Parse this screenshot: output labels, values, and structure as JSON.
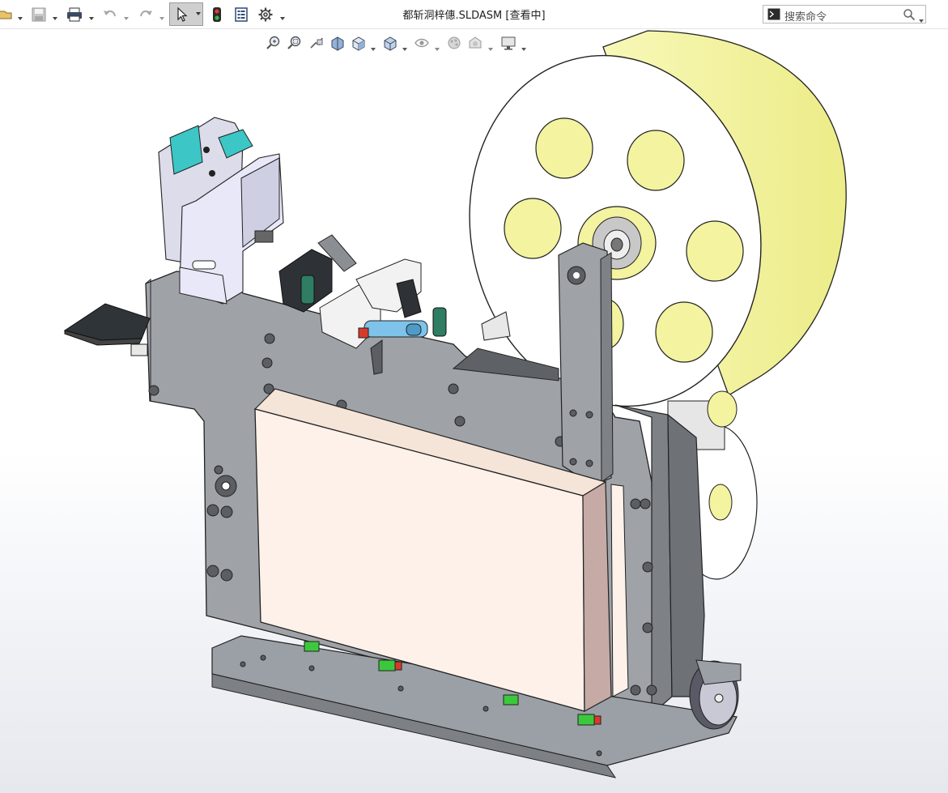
{
  "window": {
    "title": "都斩洞梓僡.SLDASM [查看中]"
  },
  "search": {
    "placeholder": "搜索命令"
  },
  "toolbar": {
    "icons": [
      "open-icon",
      "save-icon",
      "print-icon",
      "undo-icon",
      "redo-icon",
      "select-arrow-icon",
      "rebuild-traffic-light-icon",
      "file-properties-icon",
      "options-gear-icon"
    ]
  },
  "headsup_toolbar": {
    "icons": [
      "zoom-to-fit-icon",
      "zoom-to-area-icon",
      "previous-view-icon",
      "section-view-icon",
      "view-orientation-icon",
      "display-style-icon",
      "hide-show-items-icon",
      "edit-appearance-icon",
      "apply-scene-icon",
      "view-settings-icon"
    ]
  },
  "colors": {
    "plate_gray": "#9fa3a8",
    "reel_yellow": "#f3f3a0",
    "cover_peach": "#fdf1ea",
    "accent_teal": "#3dc6c6",
    "rail_green": "#3cc83c",
    "rail_red": "#d83a2a",
    "pin_blue": "#7ec3ea"
  }
}
